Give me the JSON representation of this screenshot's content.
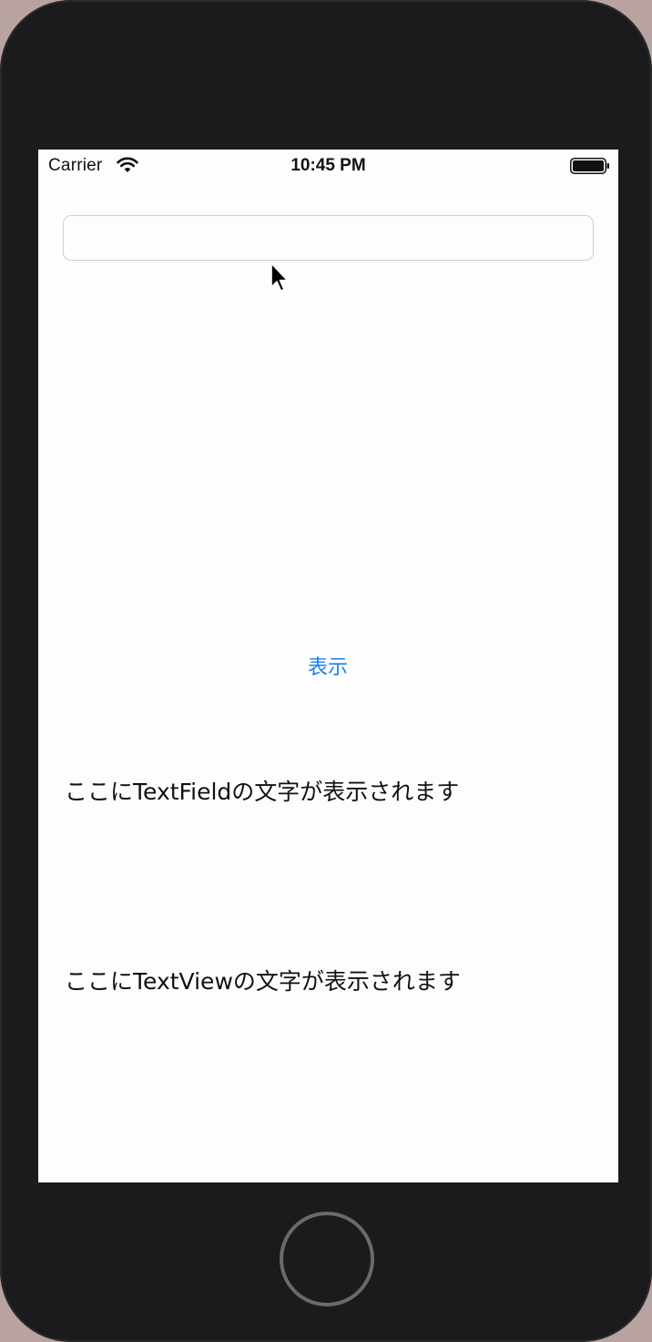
{
  "status_bar": {
    "carrier": "Carrier",
    "time": "10:45 PM",
    "wifi_icon": "wifi-icon",
    "battery_icon": "battery-icon"
  },
  "text_field": {
    "value": "",
    "placeholder": ""
  },
  "show_button": {
    "label": "表示"
  },
  "labels": {
    "textfield_label": "ここにTextFieldの文字が表示されます",
    "textview_label": "ここにTextViewの文字が表示されます"
  },
  "colors": {
    "accent": "#1a7ef2",
    "background": "#fdfdfd",
    "device_body": "#1b1b1d"
  }
}
